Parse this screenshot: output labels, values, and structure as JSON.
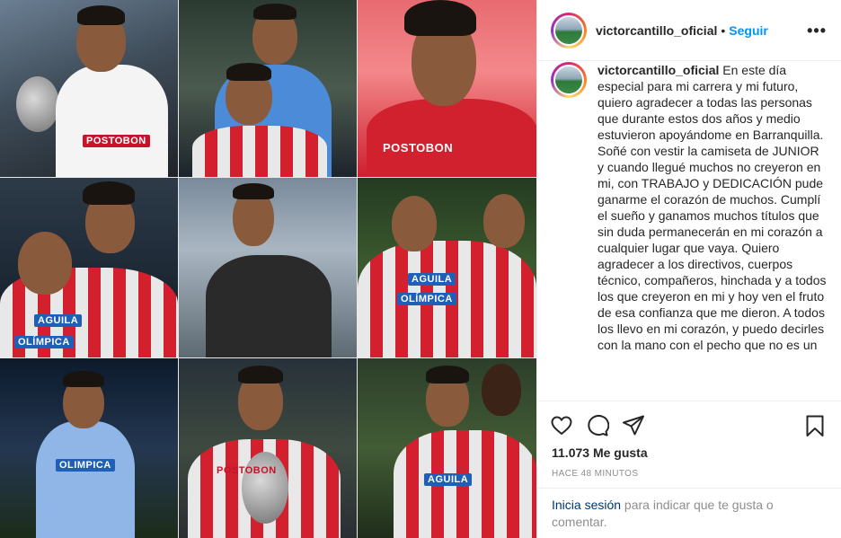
{
  "post": {
    "author": {
      "username": "victorcantillo_oficial",
      "separator": "•",
      "follow_label": "Seguir",
      "more_icon": "more-options-icon"
    },
    "media": {
      "sponsor_texts": [
        "POSTOBON",
        "POSTOBON",
        "AGUILA",
        "OLÍMPICA",
        "AGUILA",
        "OLÍMPICA",
        "OLIMPICA",
        "POSTOBON",
        "AGUILA"
      ]
    },
    "caption": {
      "username": "victorcantillo_oficial",
      "text": " En este día especial para mi carrera y mi futuro, quiero agradecer a todas las personas que durante estos dos años y medio estuvieron apoyándome en Barranquilla. Soñé con vestir la camiseta de JUNIOR y cuando llegué muchos no creyeron en mi, con TRABAJO y DEDICACIÓN pude ganarme el corazón de muchos. Cumplí el sueño y ganamos muchos títulos que sin duda permanecerán en mi corazón a cualquier lugar que vaya. Quiero agradecer a los directivos, cuerpos técnico, compañeros, hinchada y a todos los que creyeron en mi y hoy ven el fruto de esa confianza que me dieron. A todos los llevo en mi corazón, y puedo decirles con la mano con el pecho que no es un"
    },
    "actions": {
      "icons": [
        "heart-icon",
        "comment-icon",
        "share-icon",
        "bookmark-icon"
      ],
      "likes": "11.073 Me gusta",
      "timestamp": "HACE 48 MINUTOS"
    },
    "login_prompt": {
      "link": "Inicia sesión",
      "text": " para indicar que te gusta o comentar."
    }
  },
  "colors": {
    "link_blue": "#0095f6",
    "login_link": "#00376b",
    "muted": "#8e8e8e",
    "text": "#262626"
  }
}
